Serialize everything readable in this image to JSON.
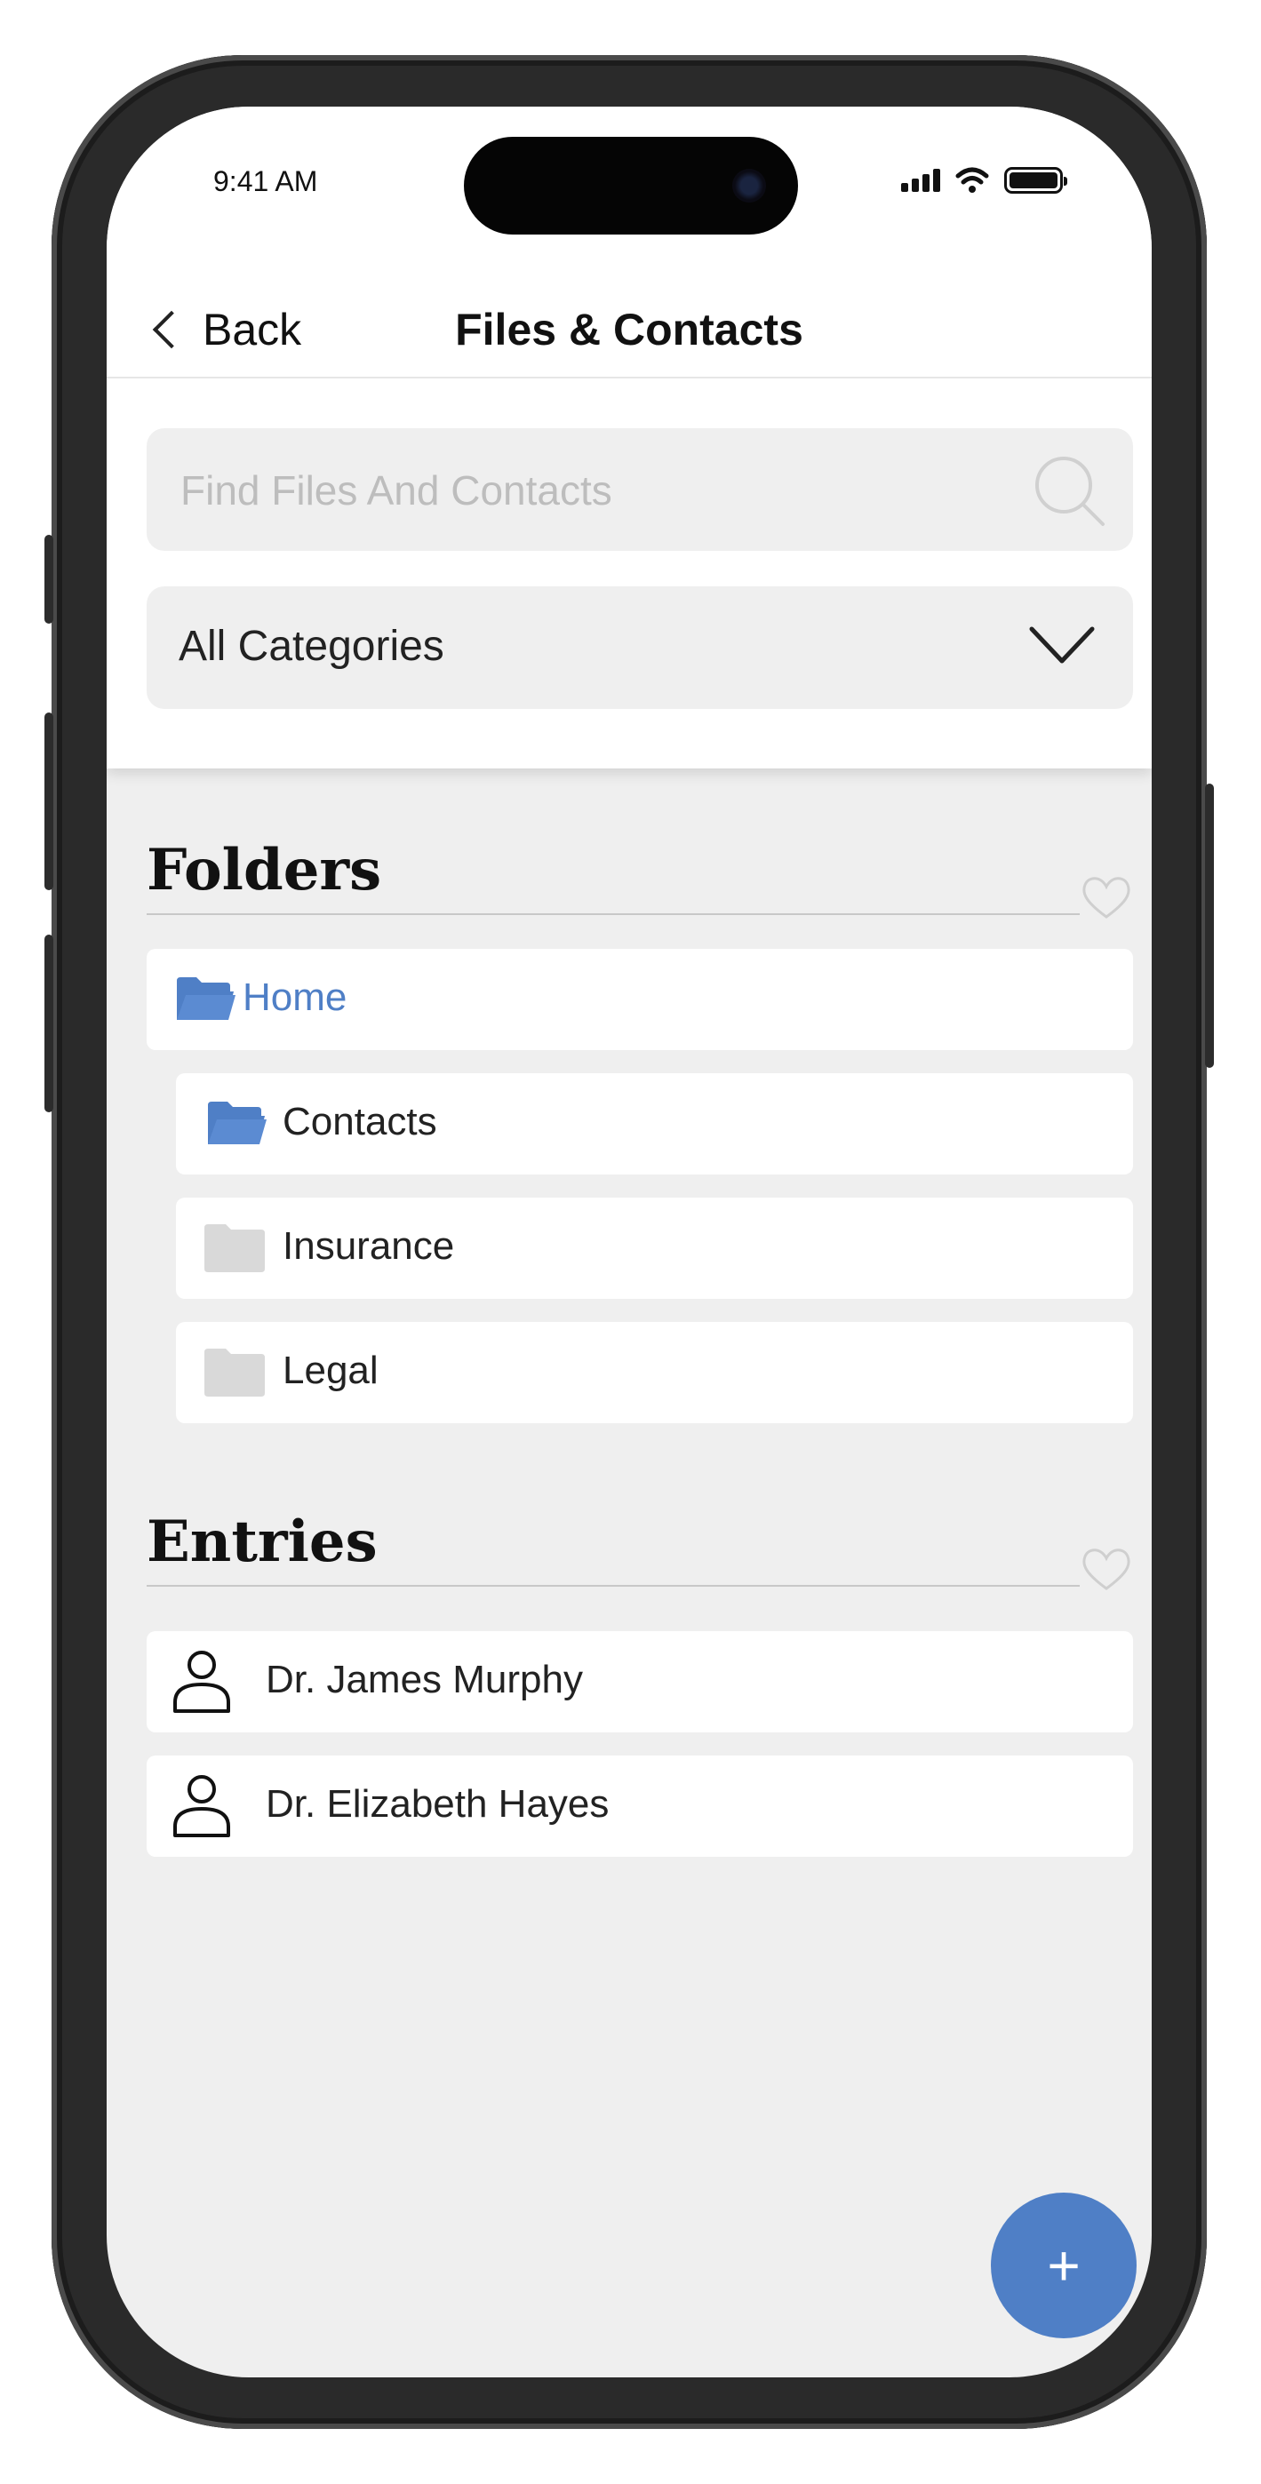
{
  "status": {
    "time": "9:41 AM"
  },
  "nav": {
    "back_label": "Back",
    "title": "Files & Contacts"
  },
  "search": {
    "placeholder": "Find Files And Contacts",
    "value": ""
  },
  "category_select": {
    "selected": "All Categories"
  },
  "folders": {
    "heading": "Folders",
    "items": [
      {
        "label": "Home",
        "icon": "folder-open-icon",
        "active": true
      },
      {
        "label": "Contacts",
        "icon": "folder-open-icon"
      },
      {
        "label": "Insurance",
        "icon": "folder-icon"
      },
      {
        "label": "Legal",
        "icon": "folder-icon"
      }
    ]
  },
  "entries": {
    "heading": "Entries",
    "items": [
      {
        "label": "Dr. James Murphy",
        "icon": "person-icon"
      },
      {
        "label": "Dr. Elizabeth Hayes",
        "icon": "person-icon"
      }
    ]
  },
  "fab": {
    "label": "+"
  },
  "colors": {
    "accent": "#4f7fc6",
    "folder_grey": "#d9d9d9",
    "background": "#efefef"
  }
}
